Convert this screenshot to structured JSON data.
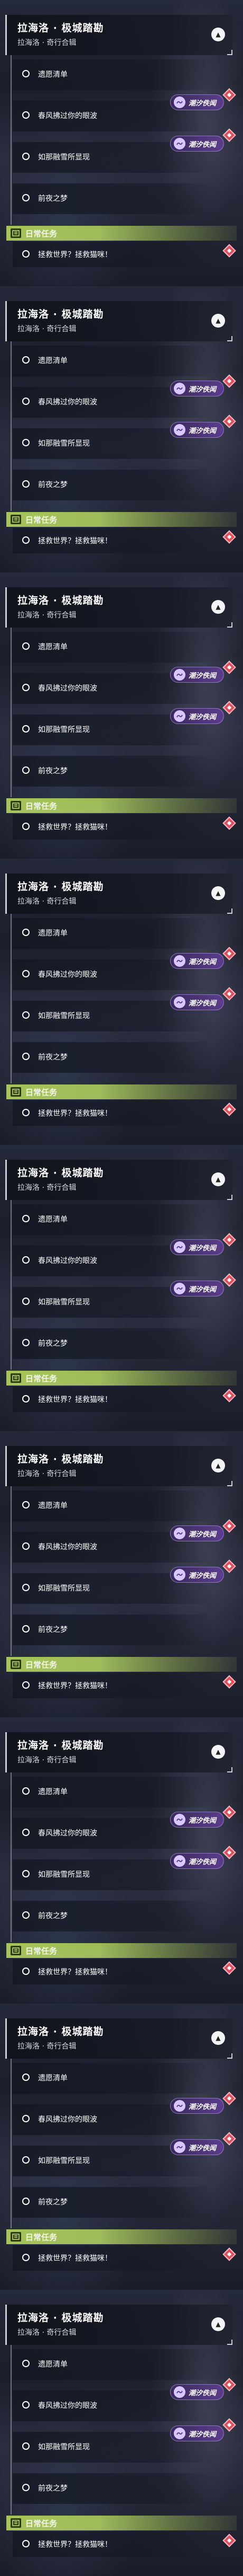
{
  "panels": [
    {
      "title": "拉海洛 · 极城踏勘",
      "subtitle": "拉海洛 · 奇行合辑",
      "tasks": [
        {
          "label": "遗愿清单",
          "badge": ""
        },
        {
          "label": "春风拂过你的眼波",
          "badge": "潮汐佚闻"
        },
        {
          "label": "如那融雪所显现",
          "badge": "潮汐佚闻"
        },
        {
          "label": "前夜之梦",
          "badge": ""
        }
      ],
      "daily": {
        "label": "日常任务",
        "task": "拯救世界？拯救猫咪！"
      }
    },
    {
      "title": "拉海洛 · 极城踏勘",
      "subtitle": "拉海洛 · 奇行合辑",
      "tasks": [
        {
          "label": "遗愿清单",
          "badge": ""
        },
        {
          "label": "春风拂过你的眼波",
          "badge": "潮汐佚闻"
        },
        {
          "label": "如那融雪所显现",
          "badge": "潮汐佚闻"
        },
        {
          "label": "前夜之梦",
          "badge": ""
        }
      ],
      "daily": {
        "label": "日常任务",
        "task": "拯救世界？拯救猫咪！"
      }
    },
    {
      "title": "拉海洛 · 极城踏勘",
      "subtitle": "拉海洛 · 奇行合辑",
      "tasks": [
        {
          "label": "遗愿清单",
          "badge": ""
        },
        {
          "label": "春风拂过你的眼波",
          "badge": "潮汐佚闻"
        },
        {
          "label": "如那融雪所显现",
          "badge": "潮汐佚闻"
        },
        {
          "label": "前夜之梦",
          "badge": ""
        }
      ],
      "daily": {
        "label": "日常任务",
        "task": "拯救世界？拯救猫咪！"
      }
    },
    {
      "title": "拉海洛 · 极城踏勘",
      "subtitle": "拉海洛 · 奇行合辑",
      "tasks": [
        {
          "label": "遗愿清单",
          "badge": ""
        },
        {
          "label": "春风拂过你的眼波",
          "badge": "潮汐佚闻"
        },
        {
          "label": "如那融雪所显现",
          "badge": "潮汐佚闻"
        },
        {
          "label": "前夜之梦",
          "badge": ""
        }
      ],
      "daily": {
        "label": "日常任务",
        "task": "拯救世界？拯救猫咪！"
      }
    },
    {
      "title": "拉海洛 · 极城踏勘",
      "subtitle": "拉海洛 · 奇行合辑",
      "tasks": [
        {
          "label": "遗愿清单",
          "badge": ""
        },
        {
          "label": "春风拂过你的眼波",
          "badge": "潮汐佚闻"
        },
        {
          "label": "如那融雪所显现",
          "badge": "潮汐佚闻"
        },
        {
          "label": "前夜之梦",
          "badge": ""
        }
      ],
      "daily": {
        "label": "日常任务",
        "task": "拯救世界？拯救猫咪！"
      }
    },
    {
      "title": "拉海洛 · 极城踏勘",
      "subtitle": "拉海洛 · 奇行合辑",
      "tasks": [
        {
          "label": "遗愿清单",
          "badge": ""
        },
        {
          "label": "春风拂过你的眼波",
          "badge": "潮汐佚闻"
        },
        {
          "label": "如那融雪所显现",
          "badge": "潮汐佚闻"
        },
        {
          "label": "前夜之梦",
          "badge": ""
        }
      ],
      "daily": {
        "label": "日常任务",
        "task": "拯救世界？拯救猫咪！"
      }
    },
    {
      "title": "拉海洛 · 极城踏勘",
      "subtitle": "拉海洛 · 奇行合辑",
      "tasks": [
        {
          "label": "遗愿清单",
          "badge": ""
        },
        {
          "label": "春风拂过你的眼波",
          "badge": "潮汐佚闻"
        },
        {
          "label": "如那融雪所显现",
          "badge": "潮汐佚闻"
        },
        {
          "label": "前夜之梦",
          "badge": ""
        }
      ],
      "daily": {
        "label": "日常任务",
        "task": "拯救世界？拯救猫咪！"
      }
    },
    {
      "title": "拉海洛 · 极城踏勘",
      "subtitle": "拉海洛 · 奇行合辑",
      "tasks": [
        {
          "label": "遗愿清单",
          "badge": ""
        },
        {
          "label": "春风拂过你的眼波",
          "badge": "潮汐佚闻"
        },
        {
          "label": "如那融雪所显现",
          "badge": "潮汐佚闻"
        },
        {
          "label": "前夜之梦",
          "badge": ""
        }
      ],
      "daily": {
        "label": "日常任务",
        "task": "拯救世界？拯救猫咪！"
      }
    },
    {
      "title": "拉海洛 · 极城踏勘",
      "subtitle": "拉海洛 · 奇行合辑",
      "tasks": [
        {
          "label": "遗愿清单",
          "badge": ""
        },
        {
          "label": "春风拂过你的眼波",
          "badge": "潮汐佚闻"
        },
        {
          "label": "如那融雪所显现",
          "badge": "潮汐佚闻"
        },
        {
          "label": "前夜之梦",
          "badge": ""
        }
      ],
      "daily": {
        "label": "日常任务",
        "task": "拯救世界？拯救猫咪！"
      }
    }
  ],
  "icons": {
    "collapse": "chevron-up-icon",
    "task_status": "circle-outline-icon",
    "badge": "tidal-tale-icon",
    "daily": "daily-task-icon",
    "track": "track-marker-icon"
  }
}
